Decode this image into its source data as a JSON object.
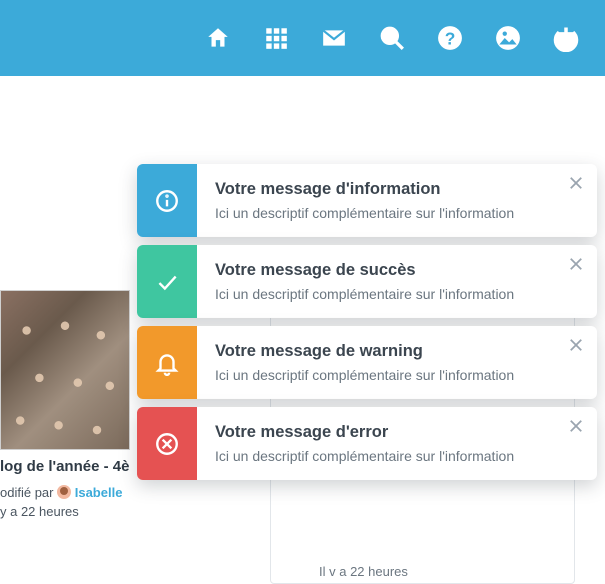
{
  "nav": {
    "items": [
      "home-icon",
      "apps-icon",
      "mail-icon",
      "search-icon",
      "help-icon",
      "image-icon",
      "power-icon"
    ]
  },
  "toasts": [
    {
      "kind": "info",
      "title": "Votre message d'information",
      "desc": "Ici un descriptif complémentaire sur l'information"
    },
    {
      "kind": "success",
      "title": "Votre message de succès",
      "desc": "Ici un descriptif complémentaire sur l'information"
    },
    {
      "kind": "warning",
      "title": "Votre message de warning",
      "desc": "Ici un descriptif complémentaire sur l'information"
    },
    {
      "kind": "error",
      "title": "Votre message d'error",
      "desc": "Ici un descriptif complémentaire sur l'information"
    }
  ],
  "post": {
    "title": "log de l'année - 4è",
    "modified_prefix": "odifié par",
    "author": "Isabelle",
    "time": "y a 22 heures"
  },
  "side": {
    "time": "Il v a 22 heures"
  },
  "colors": {
    "navbar": "#3caad9",
    "info": "#3caad9",
    "success": "#3fc6a0",
    "warning": "#f2992b",
    "error": "#e55252"
  }
}
